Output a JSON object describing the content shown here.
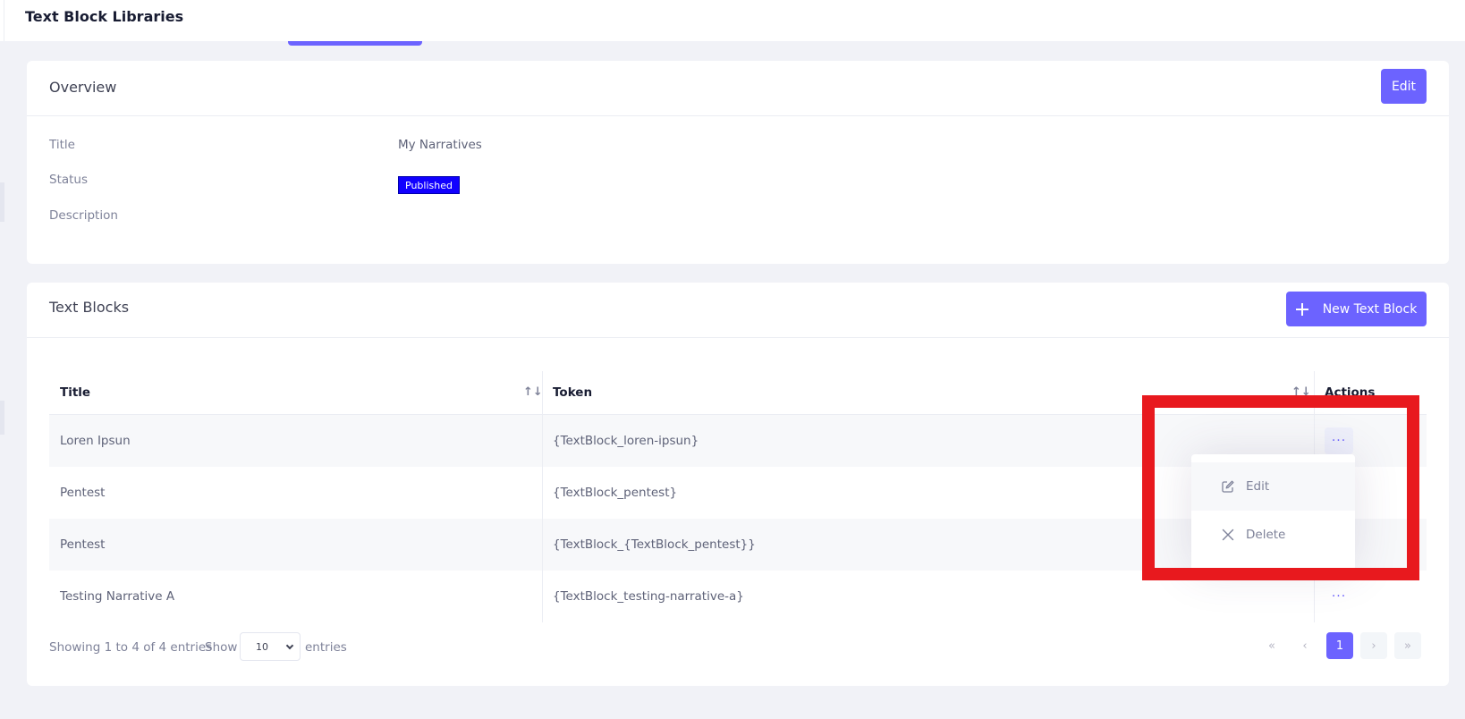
{
  "header": {
    "title": "Text Block Libraries"
  },
  "overview": {
    "title": "Overview",
    "edit_label": "Edit",
    "fields": {
      "title_label": "Title",
      "title_value": "My Narratives",
      "status_label": "Status",
      "status_value": "Published",
      "description_label": "Description",
      "description_value": ""
    }
  },
  "text_blocks": {
    "title": "Text Blocks",
    "new_button_label": "New Text Block",
    "columns": {
      "title": "Title",
      "token": "Token",
      "actions": "Actions"
    },
    "rows": [
      {
        "title": "Loren Ipsun",
        "token": "{TextBlock_loren-ipsun}"
      },
      {
        "title": "Pentest",
        "token": "{TextBlock_pentest}"
      },
      {
        "title": "Pentest",
        "token": "{TextBlock_{TextBlock_pentest}}"
      },
      {
        "title": "Testing Narrative A",
        "token": "{TextBlock_testing-narrative-a}"
      }
    ],
    "actions_glyph": "···",
    "dropdown": {
      "edit_label": "Edit",
      "delete_label": "Delete"
    },
    "footer": {
      "showing": "Showing 1 to 4 of 4 entries",
      "show_label": "Show",
      "page_size": "10",
      "entries_label": "entries",
      "current_page": "1"
    }
  },
  "colors": {
    "accent": "#6c63ff",
    "badge": "#1100ff",
    "highlight": "#e8191e"
  }
}
